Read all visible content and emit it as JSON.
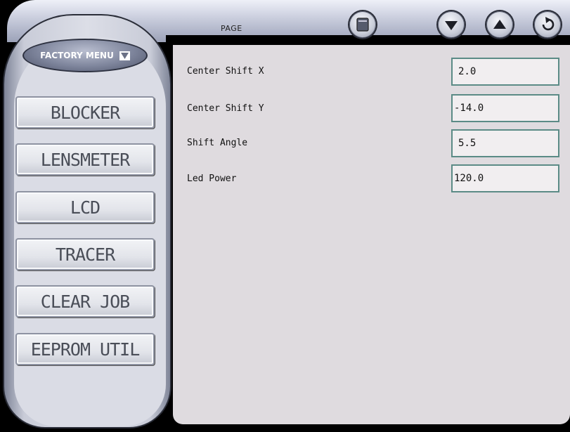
{
  "header": {
    "page_label": "PAGE",
    "buttons": [
      {
        "name": "page-button",
        "icon": "page-icon"
      },
      {
        "name": "scroll-down-button",
        "icon": "arrow-down-icon"
      },
      {
        "name": "scroll-up-button",
        "icon": "arrow-up-icon"
      },
      {
        "name": "return-button",
        "icon": "return-icon"
      }
    ]
  },
  "sidebar": {
    "menu_label": "FACTORY MENU",
    "menu_icon": "triangle-down-icon",
    "items": [
      {
        "label": "BLOCKER"
      },
      {
        "label": "LENSMETER"
      },
      {
        "label": "LCD"
      },
      {
        "label": "TRACER"
      },
      {
        "label": "CLEAR JOB"
      },
      {
        "label": "EEPROM UTIL"
      }
    ]
  },
  "fields": [
    {
      "label": "Center Shift X",
      "value": "2.0"
    },
    {
      "label": "Center Shift Y",
      "value": "-14.0"
    },
    {
      "label": "Shift Angle",
      "value": "5.5"
    },
    {
      "label": "Led Power",
      "value": "120.0"
    }
  ],
  "colors": {
    "field_border": "#5b8b86",
    "panel_bg": "#dfdbdf"
  }
}
